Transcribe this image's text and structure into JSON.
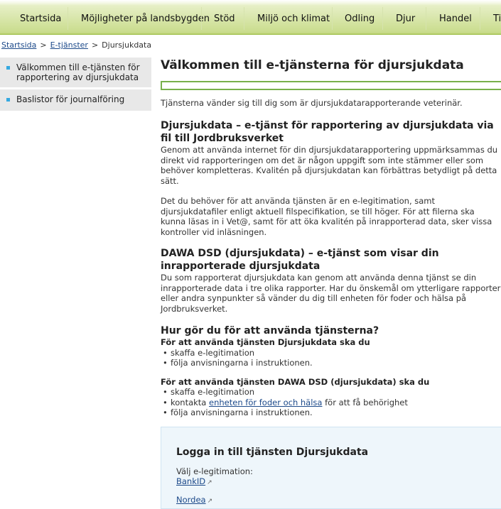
{
  "nav": [
    "Startsida",
    "Möjligheter på landsbygden",
    "Stöd",
    "Miljö och klimat",
    "Odling",
    "Djur",
    "Handel",
    "Ti"
  ],
  "breadcrumb": {
    "home": "Startsida",
    "section": "E-tjänster",
    "current": "Djursjukdata",
    "sep": ">"
  },
  "sidebar": {
    "items": [
      {
        "label": "Välkommen till e-tjänsten för rapportering av djursjukdata"
      },
      {
        "label": "Baslistor för journalföring"
      }
    ]
  },
  "main": {
    "title": "Välkommen till e-tjänsterna för djursjukdata",
    "intro": "Tjänsterna vänder sig till dig som är djursjukdatarapporterande veterinär.",
    "section1": {
      "heading": "Djursjukdata – e-tjänst för rapportering av djursjukdata via fil till Jordbruksverket",
      "p1": "Genom att använda internet för din djursjukdatarapportering uppmärksammas du direkt vid rapporteringen om det är någon uppgift som inte stämmer eller som behöver kompletteras. Kvalitén på djursjukdatan kan förbättras betydligt på detta sätt.",
      "p2": "Det du behöver för att använda tjänsten är en e-legitimation, samt djursjukdatafiler enligt aktuell filspecifikation, se till höger. För att filerna ska kunna läsas in i Vet@, samt för att öka kvalitén på inrapporterad data, sker vissa kontroller vid inläsningen."
    },
    "section2": {
      "heading": "DAWA DSD (djursjukdata) – e-tjänst som visar din inrapporterade djursjukdata",
      "p1": "Du som rapporterat djursjukdata kan genom att använda denna tjänst se din inrapporterade data i tre olika rapporter. Har du önskemål om ytterligare rapporter eller andra synpunkter så vänder du dig till enheten för foder och hälsa på Jordbruksverket."
    },
    "section3": {
      "heading": "Hur gör du för att använda tjänsterna?",
      "sub1": "För att använda tjänsten Djursjukdata ska du",
      "list1": [
        "skaffa e-legitimation",
        "följa anvisningarna i instruktionen."
      ],
      "sub2": "För att använda tjänsten DAWA DSD (djursjukdata) ska du",
      "list2_0": "skaffa e-legitimation",
      "list2_1_link": "enheten för foder och hälsa",
      "list2_1_pre": "kontakta",
      "list2_1_post": "för att få behörighet",
      "list2_2": "följa anvisningarna i instruktionen."
    }
  },
  "login": {
    "heading": "Logga in till tjänsten Djursjukdata",
    "label": "Välj e-legitimation:",
    "options": [
      "BankID",
      "Nordea"
    ]
  },
  "icons": {
    "external": "external-link-icon",
    "bullet": "square-bullet-icon"
  },
  "colors": {
    "accent": "#78b04b",
    "link": "#1d4a8a",
    "bullet": "#35a9e0"
  }
}
